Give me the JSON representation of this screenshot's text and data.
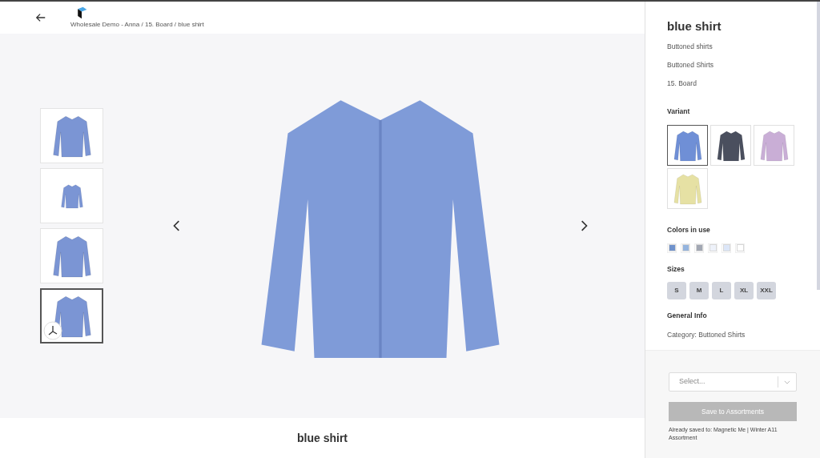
{
  "header": {
    "breadcrumb": "Wholesale Demo - Anna / 15. Board / blue shirt"
  },
  "gallery": {
    "thumbnails": [
      {
        "selected": false,
        "kind": "front"
      },
      {
        "selected": false,
        "kind": "side"
      },
      {
        "selected": false,
        "kind": "back"
      },
      {
        "selected": true,
        "kind": "model"
      }
    ]
  },
  "caption": "blue shirt",
  "details": {
    "title": "blue shirt",
    "lines": [
      "Buttoned shirts",
      "Buttoned Shirts",
      "15. Board"
    ],
    "variant_label": "Variant",
    "variants": [
      {
        "color": "#6f8fd6",
        "selected": true
      },
      {
        "color": "#4a4f5e",
        "selected": false
      },
      {
        "color": "#c9aed6",
        "selected": false
      },
      {
        "color": "#e6e1a4",
        "selected": false
      }
    ],
    "colors_label": "Colors in use",
    "colors": [
      {
        "color": "#6f92cc"
      },
      {
        "color": "#94b4de"
      },
      {
        "color": "#a2a7b3"
      },
      {
        "color": "#eef2fa"
      },
      {
        "color": "#dce6f8"
      },
      {
        "color": "#ffffff"
      }
    ],
    "sizes_label": "Sizes",
    "sizes": [
      "S",
      "M",
      "L",
      "XL",
      "XXL"
    ],
    "general_label": "General Info",
    "category": "Category: Buttoned Shirts"
  },
  "footer": {
    "select_placeholder": "Select...",
    "save_button": {
      "label": "Save to Assortments",
      "disabled": true
    },
    "saved_note": "Already saved to: Magnetic Me | Winter A11 Assortment"
  }
}
